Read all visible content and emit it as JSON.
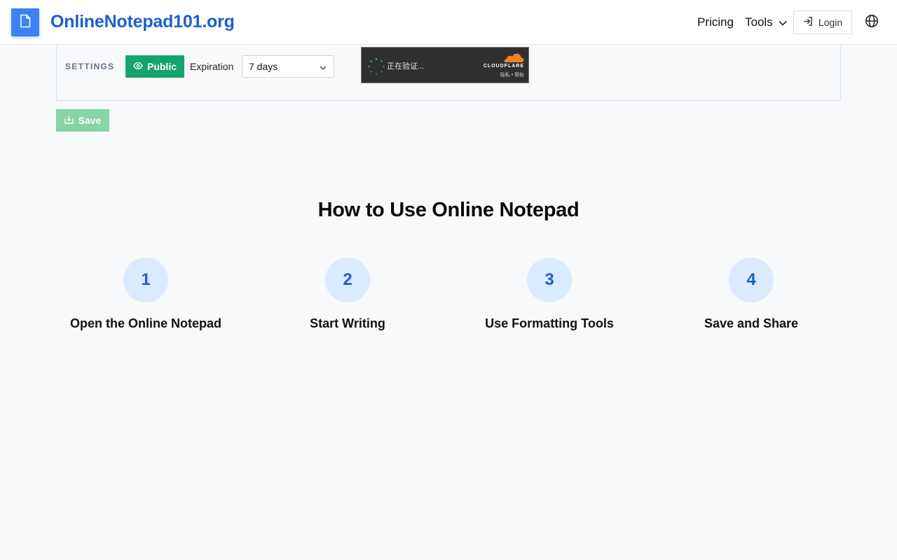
{
  "header": {
    "brand": "OnlineNotepad101.org",
    "nav": {
      "pricing": "Pricing",
      "tools": "Tools"
    },
    "login_label": "Login",
    "icons": {
      "logo": "document-icon",
      "tools_chevron": "chevron-down-icon",
      "login": "login-arrow-icon",
      "language": "globe-icon"
    }
  },
  "settings": {
    "label": "SETTINGS",
    "visibility_label": "Public",
    "expiration_label": "Expiration",
    "expiration_value": "7 days"
  },
  "captcha": {
    "status": "正在验证...",
    "brand": "CLOUDFLARE",
    "links": "隐私 • 帮助"
  },
  "save_label": "Save",
  "howto": {
    "title": "How to Use Online Notepad",
    "steps": [
      {
        "number": "1",
        "title": "Open the Online Notepad"
      },
      {
        "number": "2",
        "title": "Start Writing"
      },
      {
        "number": "3",
        "title": "Use Formatting Tools"
      },
      {
        "number": "4",
        "title": "Save and Share"
      }
    ]
  },
  "colors": {
    "brand_blue": "#1d5fd0",
    "logo_blue": "#3b82f6",
    "public_green": "#15a46e",
    "save_green_disabled": "#88d3a8",
    "step_circle_bg": "#dbeafe",
    "cloudflare_orange": "#f38020"
  }
}
